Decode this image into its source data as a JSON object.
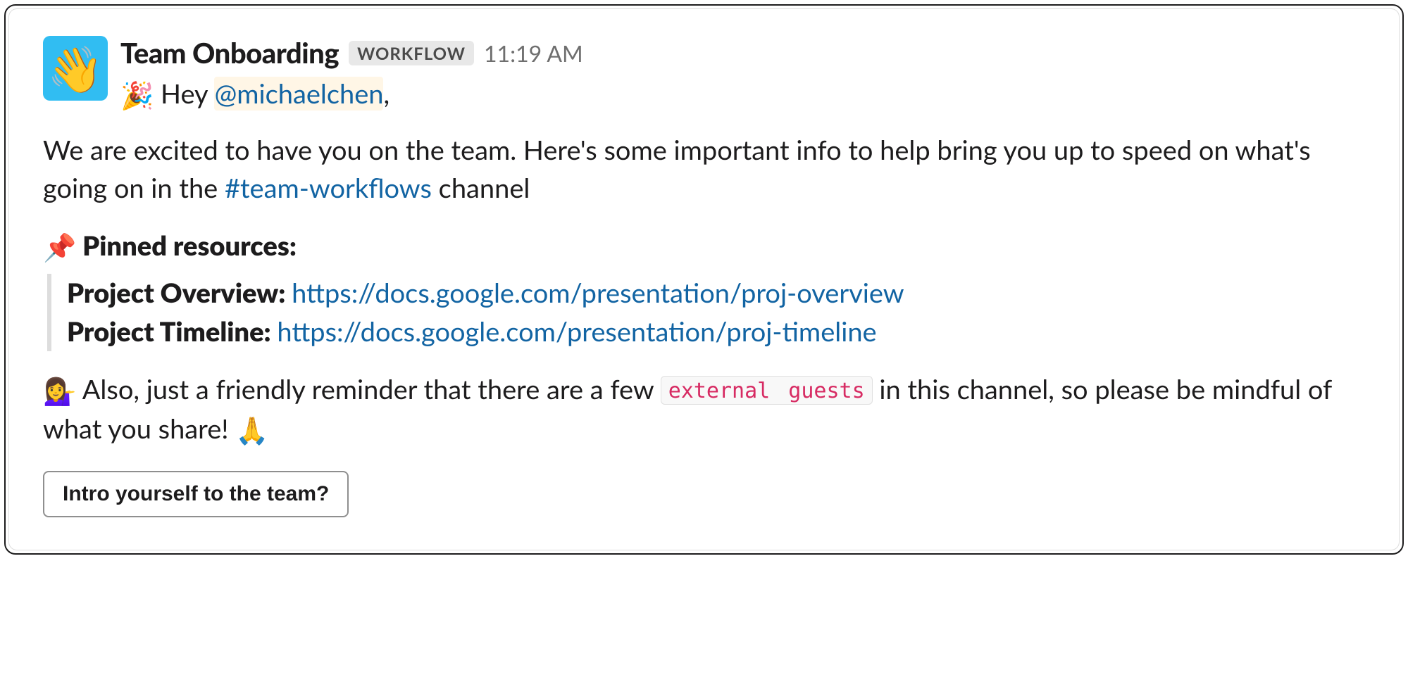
{
  "message": {
    "avatar_emoji": "👋",
    "sender": "Team Onboarding",
    "badge": "WORKFLOW",
    "timestamp": "11:19 AM",
    "line1": {
      "emoji": "🎉",
      "prefix": " Hey ",
      "mention": "@michaelchen",
      "suffix": ","
    },
    "body_intro_before_channel": "We are excited to have you on the team. Here's some important info to help bring you up to speed on what's going on in the ",
    "channel": "#team-workflows",
    "body_intro_after_channel": " channel",
    "pinned": {
      "emoji": "📌",
      "heading": " Pinned resources:",
      "items": [
        {
          "label": "Project Overview: ",
          "url": "https://docs.google.com/presentation/proj-overview"
        },
        {
          "label": "Project Timeline: ",
          "url": "https://docs.google.com/presentation/proj-timeline"
        }
      ]
    },
    "reminder": {
      "emoji": "💁‍♀️",
      "text_before_code": " Also, just a friendly reminder that there are a few ",
      "code": "external guests",
      "text_after_code": " in this channel, so please be mindful of what you share! ",
      "end_emoji": "🙏"
    },
    "cta_label": "Intro yourself to the team?"
  }
}
